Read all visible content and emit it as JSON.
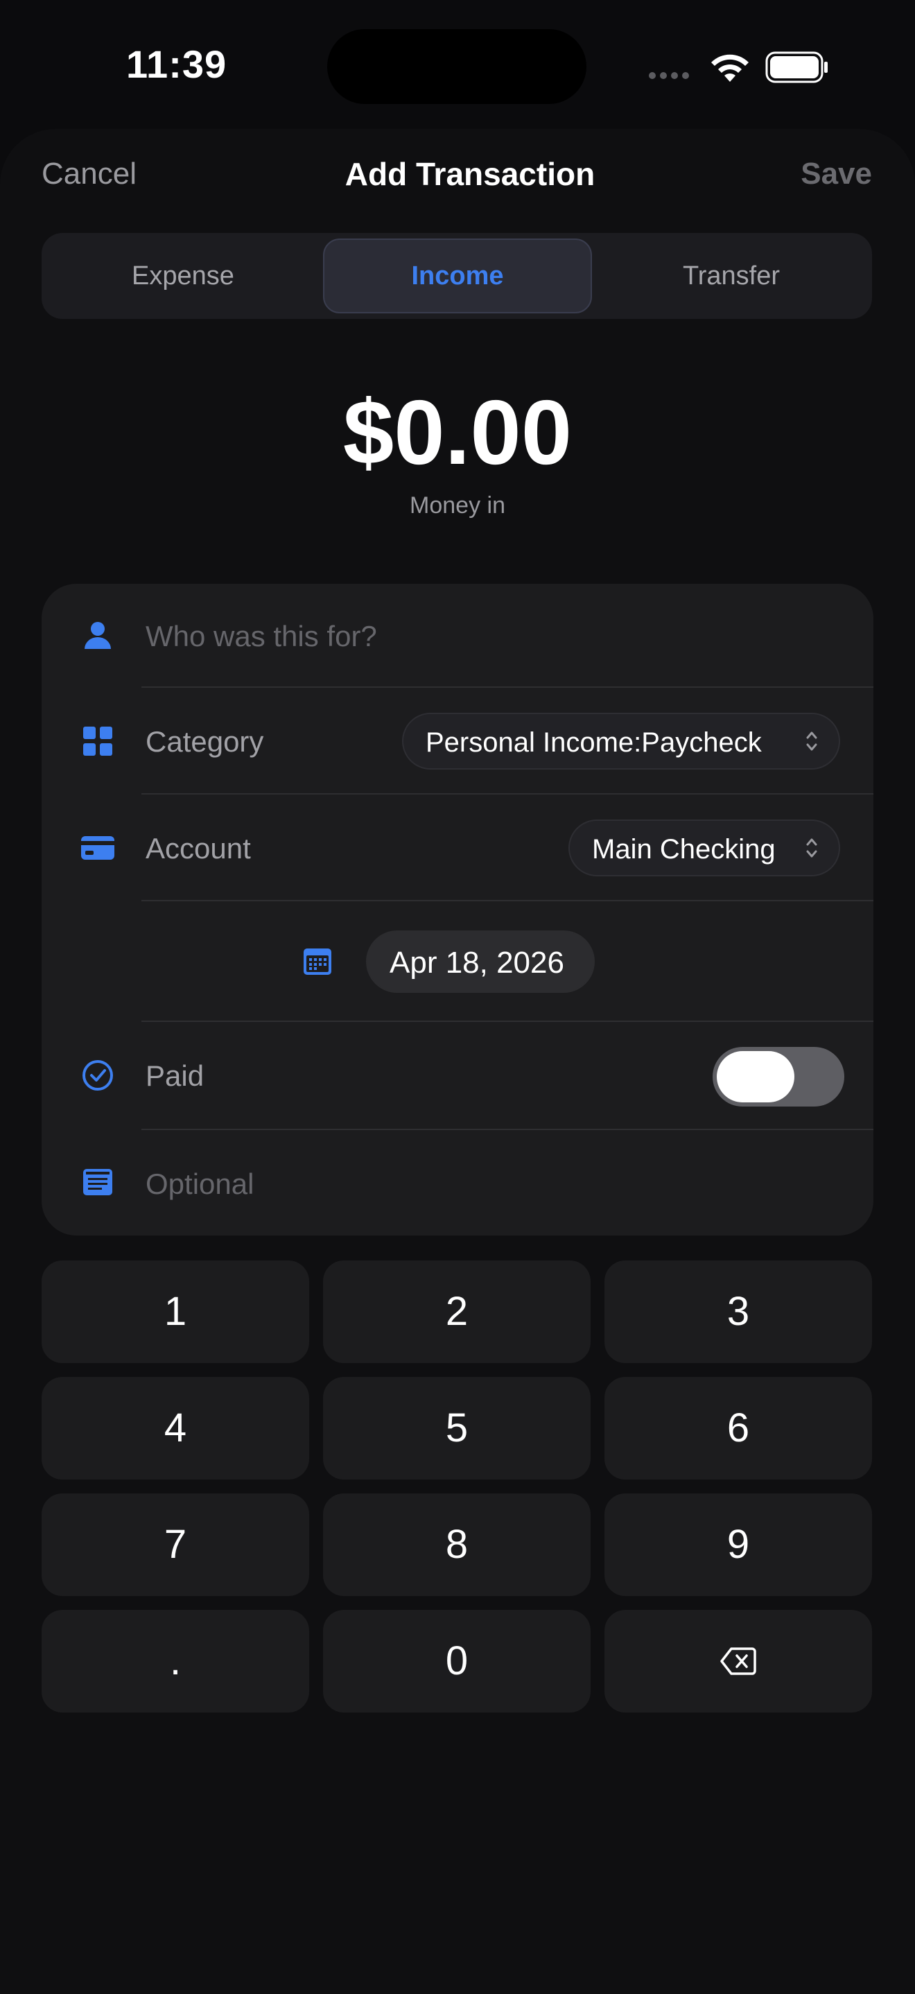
{
  "status_bar": {
    "time": "11:39"
  },
  "nav": {
    "cancel_label": "Cancel",
    "title": "Add Transaction",
    "save_label": "Save"
  },
  "segments": {
    "items": [
      "Expense",
      "Income",
      "Transfer"
    ],
    "selected": "Income"
  },
  "amount": {
    "value": "$0.00",
    "caption": "Money in"
  },
  "form": {
    "payee_placeholder": "Who was this for?",
    "category_label": "Category",
    "category_value": "Personal Income:Paycheck",
    "account_label": "Account",
    "account_value": "Main Checking",
    "date_value": "Apr 18, 2026",
    "paid_label": "Paid",
    "paid_on": false,
    "notes_placeholder": "Optional"
  },
  "keypad": {
    "keys": [
      "1",
      "2",
      "3",
      "4",
      "5",
      "6",
      "7",
      "8",
      "9",
      ".",
      "0"
    ]
  },
  "colors": {
    "accent": "#3d7ff0",
    "background": "#0b0b0d",
    "card": "#1c1c1e"
  }
}
